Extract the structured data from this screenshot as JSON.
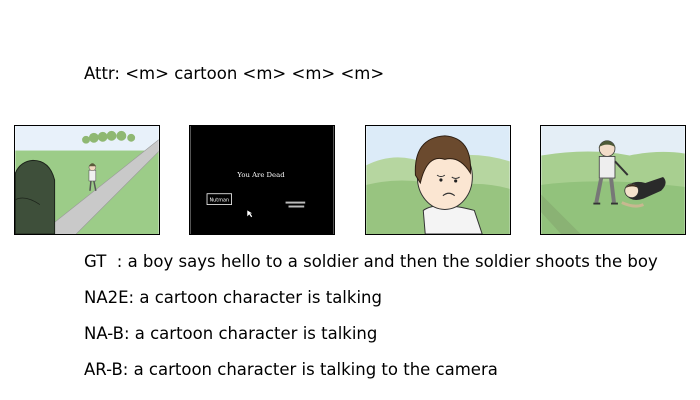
{
  "attr_line": "Attr: <m> cartoon <m> <m> <m>",
  "frames": [
    {
      "description": "soldier on a path in a green field with a boy"
    },
    {
      "description": "black screen with text",
      "title_text": "You Are Dead",
      "button_text": "Nutman"
    },
    {
      "description": "close-up of a sad boy outdoors"
    },
    {
      "description": "soldier standing over a fallen boy"
    }
  ],
  "captions": [
    "GT  : a boy says hello to a soldier and then the soldier shoots the boy",
    "NA2E: a cartoon character is talking",
    "NA-B: a cartoon character is talking",
    "AR-B: a cartoon character is talking to the camera"
  ]
}
